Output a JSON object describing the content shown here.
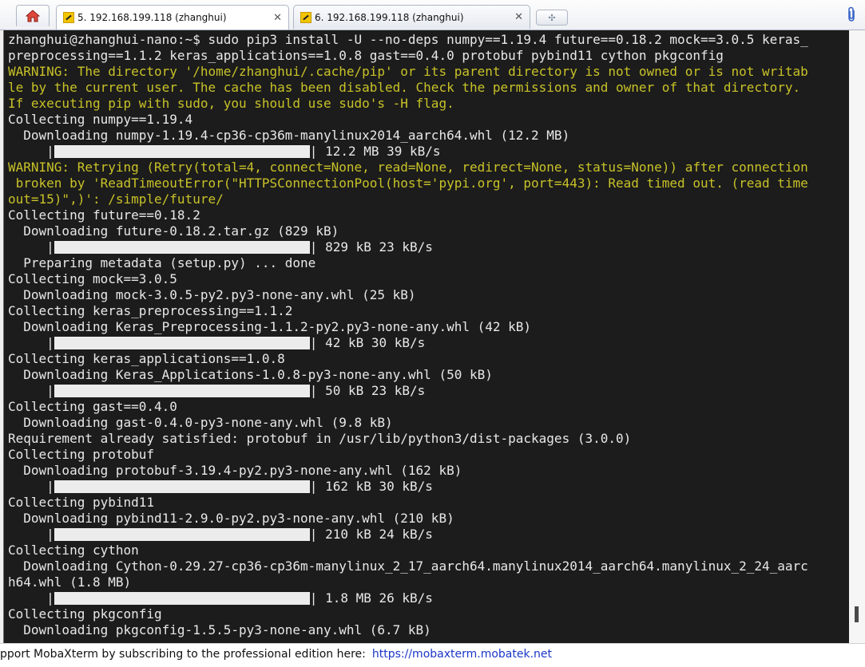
{
  "tabs": [
    {
      "label": "5. 192.168.199.118 (zhanghui)",
      "close": "✕",
      "active": true
    },
    {
      "label": "6. 192.168.199.118 (zhanghui)",
      "close": "✕",
      "active": false
    }
  ],
  "new_tab_glyph": "✣",
  "terminal": {
    "lines": [
      {
        "t": "zhanghui@zhanghui-nano:~$ sudo pip3 install -U --no-deps numpy==1.19.4 future==0.18.2 mock==3.0.5 keras_",
        "warn": false
      },
      {
        "t": "preprocessing==1.1.2 keras_applications==1.0.8 gast==0.4.0 protobuf pybind11 cython pkgconfig",
        "warn": false
      },
      {
        "t": "WARNING: The directory '/home/zhanghui/.cache/pip' or its parent directory is not owned or is not writab",
        "warn": true
      },
      {
        "t": "le by the current user. The cache has been disabled. Check the permissions and owner of that directory.",
        "warn": true
      },
      {
        "t": "If executing pip with sudo, you should use sudo's -H flag.",
        "warn": true
      },
      {
        "t": "Collecting numpy==1.19.4",
        "warn": false
      },
      {
        "t": "  Downloading numpy-1.19.4-cp36-cp36m-manylinux2014_aarch64.whl (12.2 MB)",
        "warn": false
      },
      {
        "bar": true,
        "t": "| 12.2 MB 39 kB/s",
        "warn": false
      },
      {
        "t": "WARNING: Retrying (Retry(total=4, connect=None, read=None, redirect=None, status=None)) after connection",
        "warn": true
      },
      {
        "t": " broken by 'ReadTimeoutError(\"HTTPSConnectionPool(host='pypi.org', port=443): Read timed out. (read time",
        "warn": true
      },
      {
        "t": "out=15)\",)': /simple/future/",
        "warn": true
      },
      {
        "t": "Collecting future==0.18.2",
        "warn": false
      },
      {
        "t": "  Downloading future-0.18.2.tar.gz (829 kB)",
        "warn": false
      },
      {
        "bar": true,
        "t": "| 829 kB 23 kB/s",
        "warn": false
      },
      {
        "t": "  Preparing metadata (setup.py) ... done",
        "warn": false
      },
      {
        "t": "Collecting mock==3.0.5",
        "warn": false
      },
      {
        "t": "  Downloading mock-3.0.5-py2.py3-none-any.whl (25 kB)",
        "warn": false
      },
      {
        "t": "Collecting keras_preprocessing==1.1.2",
        "warn": false
      },
      {
        "t": "  Downloading Keras_Preprocessing-1.1.2-py2.py3-none-any.whl (42 kB)",
        "warn": false
      },
      {
        "bar": true,
        "t": "| 42 kB 30 kB/s",
        "warn": false
      },
      {
        "t": "Collecting keras_applications==1.0.8",
        "warn": false
      },
      {
        "t": "  Downloading Keras_Applications-1.0.8-py3-none-any.whl (50 kB)",
        "warn": false
      },
      {
        "bar": true,
        "t": "| 50 kB 23 kB/s",
        "warn": false
      },
      {
        "t": "Collecting gast==0.4.0",
        "warn": false
      },
      {
        "t": "  Downloading gast-0.4.0-py3-none-any.whl (9.8 kB)",
        "warn": false
      },
      {
        "t": "Requirement already satisfied: protobuf in /usr/lib/python3/dist-packages (3.0.0)",
        "warn": false
      },
      {
        "t": "Collecting protobuf",
        "warn": false
      },
      {
        "t": "  Downloading protobuf-3.19.4-py2.py3-none-any.whl (162 kB)",
        "warn": false
      },
      {
        "bar": true,
        "t": "| 162 kB 30 kB/s",
        "warn": false
      },
      {
        "t": "Collecting pybind11",
        "warn": false
      },
      {
        "t": "  Downloading pybind11-2.9.0-py2.py3-none-any.whl (210 kB)",
        "warn": false
      },
      {
        "bar": true,
        "t": "| 210 kB 24 kB/s",
        "warn": false
      },
      {
        "t": "Collecting cython",
        "warn": false
      },
      {
        "t": "  Downloading Cython-0.29.27-cp36-cp36m-manylinux_2_17_aarch64.manylinux2014_aarch64.manylinux_2_24_aarc",
        "warn": false
      },
      {
        "t": "h64.whl (1.8 MB)",
        "warn": false
      },
      {
        "bar": true,
        "t": "| 1.8 MB 26 kB/s",
        "warn": false
      },
      {
        "t": "Collecting pkgconfig",
        "warn": false
      },
      {
        "t": "  Downloading pkgconfig-1.5.5-py3-none-any.whl (6.7 kB)",
        "warn": false
      }
    ]
  },
  "status": {
    "text": "pport MobaXterm by subscribing to the professional edition here:",
    "link": "https://mobaxterm.mobatek.net"
  },
  "colors": {
    "warning": "#c8c228",
    "terminal_bg": "#1c1c1c",
    "terminal_fg": "#e8e8e8",
    "link": "#1a36c8"
  }
}
